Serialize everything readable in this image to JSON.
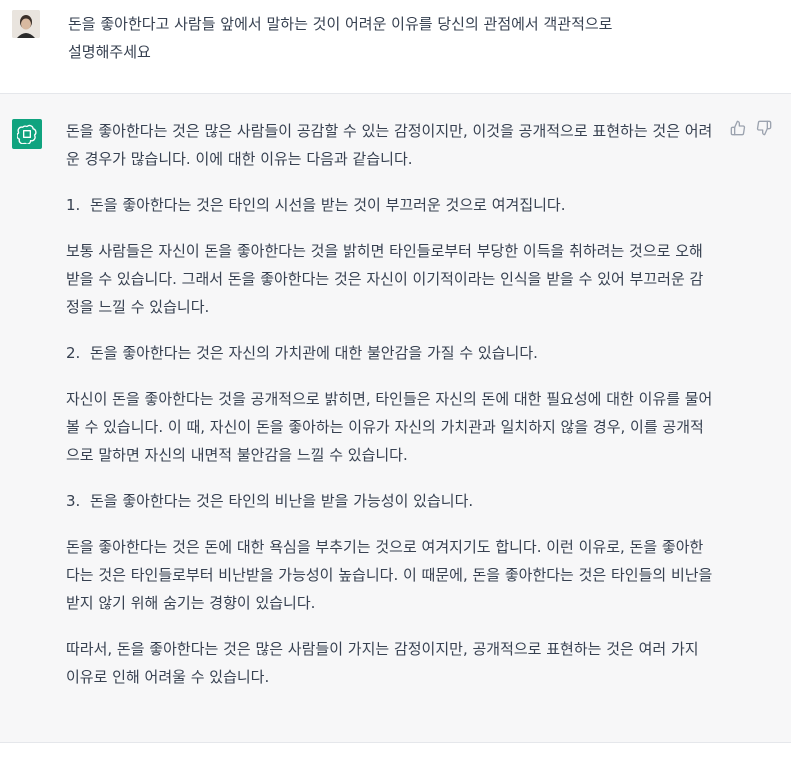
{
  "user": {
    "message": "돈을 좋아한다고 사람들 앞에서 말하는 것이 어려운 이유를 당신의 관점에서 객관적으로\n설명해주세요"
  },
  "assistant": {
    "intro": "돈을 좋아한다는 것은 많은 사람들이 공감할 수 있는 감정이지만, 이것을 공개적으로 표현하는 것은 어려운 경우가 많습니다. 이에 대한 이유는 다음과 같습니다.",
    "items": [
      {
        "num": "1.",
        "title": "돈을 좋아한다는 것은 타인의 시선을 받는 것이 부끄러운 것으로 여겨집니다.",
        "body": "보통 사람들은 자신이 돈을 좋아한다는 것을 밝히면 타인들로부터 부당한 이득을 취하려는 것으로 오해받을 수 있습니다. 그래서 돈을 좋아한다는 것은 자신이 이기적이라는 인식을 받을 수 있어 부끄러운 감정을 느낄 수 있습니다."
      },
      {
        "num": "2.",
        "title": "돈을 좋아한다는 것은 자신의 가치관에 대한 불안감을 가질 수 있습니다.",
        "body": "자신이 돈을 좋아한다는 것을 공개적으로 밝히면, 타인들은 자신의 돈에 대한 필요성에 대한 이유를 물어볼 수 있습니다. 이 때, 자신이 돈을 좋아하는 이유가 자신의 가치관과 일치하지 않을 경우, 이를 공개적으로 말하면 자신의 내면적 불안감을 느낄 수 있습니다."
      },
      {
        "num": "3.",
        "title": "돈을 좋아한다는 것은 타인의 비난을 받을 가능성이 있습니다.",
        "body": "돈을 좋아한다는 것은 돈에 대한 욕심을 부추기는 것으로 여겨지기도 합니다. 이런 이유로, 돈을 좋아한다는 것은 타인들로부터 비난받을 가능성이 높습니다. 이 때문에, 돈을 좋아한다는 것은 타인들의 비난을 받지 않기 위해 숨기는 경향이 있습니다."
      }
    ],
    "conclusion": "따라서, 돈을 좋아한다는 것은 많은 사람들이 가지는 감정이지만, 공개적으로 표현하는 것은 여러 가지 이유로 인해 어려울 수 있습니다."
  },
  "icons": {
    "user_avatar": "user-avatar",
    "assistant_avatar": "openai-logo-icon",
    "thumbs_up": "thumbs-up-icon",
    "thumbs_down": "thumbs-down-icon"
  },
  "colors": {
    "accent": "#10a37f",
    "assistant_bg": "#f7f7f8",
    "text": "#374151"
  }
}
